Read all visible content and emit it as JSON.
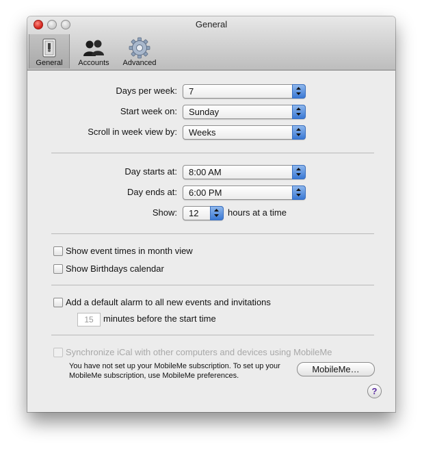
{
  "window": {
    "title": "General"
  },
  "toolbar": {
    "items": [
      {
        "label": "General",
        "icon": "switch-icon",
        "selected": true
      },
      {
        "label": "Accounts",
        "icon": "people-icon",
        "selected": false
      },
      {
        "label": "Advanced",
        "icon": "gear-icon",
        "selected": false
      }
    ]
  },
  "week": {
    "days_per_week_label": "Days per week:",
    "days_per_week_value": "7",
    "start_week_label": "Start week on:",
    "start_week_value": "Sunday",
    "scroll_label": "Scroll in week view by:",
    "scroll_value": "Weeks"
  },
  "day": {
    "starts_label": "Day starts at:",
    "starts_value": "8:00 AM",
    "ends_label": "Day ends at:",
    "ends_value": "6:00 PM",
    "show_label": "Show:",
    "show_value": "12",
    "show_suffix": "hours at a time"
  },
  "options": {
    "event_times_label": "Show event times in month view",
    "birthdays_label": "Show Birthdays calendar"
  },
  "alarm": {
    "label": "Add a default alarm to all new events and invitations",
    "minutes_value": "15",
    "minutes_suffix": "minutes before the start time"
  },
  "mobileme": {
    "sync_label": "Synchronize iCal with other computers and devices using MobileMe",
    "note_line1": "You have not set up your MobileMe subscription. To set up your",
    "note_line2": "MobileMe subscription, use MobileMe preferences.",
    "button_label": "MobileMe…"
  },
  "help": {
    "label": "?"
  },
  "colors": {
    "accent": "#3a78d4",
    "window_bg": "#ececec",
    "separator": "#b8b8b8"
  }
}
